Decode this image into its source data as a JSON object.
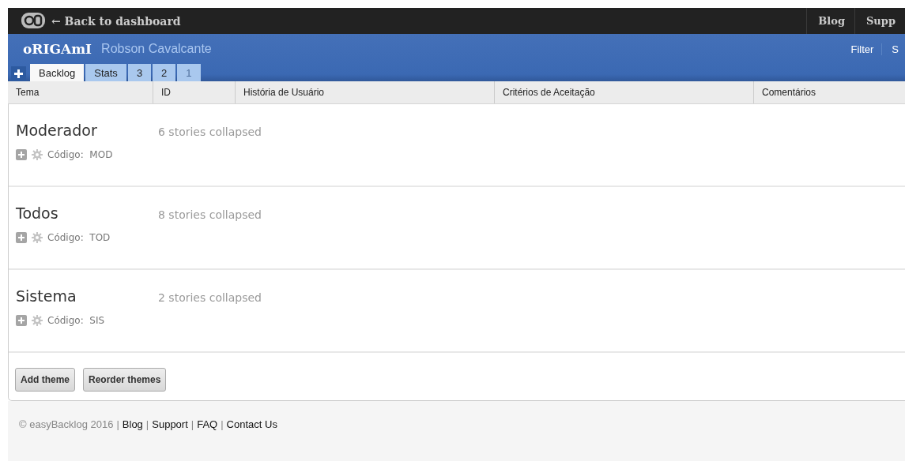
{
  "top_bar": {
    "back_link": "← Back to dashboard",
    "links": [
      "Blog",
      "Supp"
    ]
  },
  "header": {
    "title": "oRIGAmI",
    "owner": "Robson Cavalcante",
    "actions": [
      "Filter",
      "S"
    ]
  },
  "tabs": [
    {
      "label": "Backlog",
      "selected": true,
      "disabled": false
    },
    {
      "label": "Stats",
      "selected": false,
      "disabled": false
    },
    {
      "label": "3",
      "selected": false,
      "disabled": false
    },
    {
      "label": "2",
      "selected": false,
      "disabled": false
    },
    {
      "label": "1",
      "selected": false,
      "disabled": true
    }
  ],
  "table": {
    "columns": [
      "Tema",
      "ID",
      "História de Usuário",
      "Critérios de Aceitação",
      "Comentários"
    ]
  },
  "themes": [
    {
      "name": "Moderador",
      "summary": "6 stories collapsed",
      "code_label": "Código:",
      "code": "MOD"
    },
    {
      "name": "Todos",
      "summary": "8 stories collapsed",
      "code_label": "Código:",
      "code": "TOD"
    },
    {
      "name": "Sistema",
      "summary": "2 stories collapsed",
      "code_label": "Código:",
      "code": "SIS"
    }
  ],
  "buttons": [
    "Add theme",
    "Reorder themes"
  ],
  "footer": [
    {
      "kind": "text",
      "text": "© easyBacklog 2016"
    },
    {
      "kind": "sep",
      "text": "|"
    },
    {
      "kind": "link",
      "text": "Blog"
    },
    {
      "kind": "sep",
      "text": "|"
    },
    {
      "kind": "link",
      "text": "Support"
    },
    {
      "kind": "sep",
      "text": "|"
    },
    {
      "kind": "link",
      "text": "FAQ"
    },
    {
      "kind": "sep",
      "text": "|"
    },
    {
      "kind": "link",
      "text": "Contact Us"
    }
  ]
}
